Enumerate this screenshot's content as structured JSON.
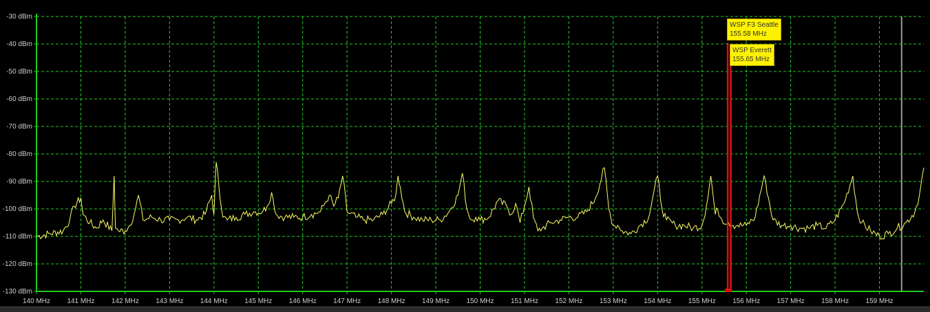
{
  "chart_data": {
    "type": "line",
    "title": "",
    "xlabel": "",
    "ylabel": "",
    "x_unit": "MHz",
    "y_unit": "dBm",
    "xlim": [
      140,
      160
    ],
    "ylim": [
      -130,
      -30
    ],
    "x_ticks": [
      "140 MHz",
      "141 MHz",
      "142 MHz",
      "143 MHz",
      "144 MHz",
      "145 MHz",
      "146 MHz",
      "147 MHz",
      "148 MHz",
      "149 MHz",
      "150 MHz",
      "151 MHz",
      "152 MHz",
      "153 MHz",
      "154 MHz",
      "155 MHz",
      "156 MHz",
      "157 MHz",
      "158 MHz",
      "159 MHz"
    ],
    "y_ticks": [
      "-30 dBm",
      "-40 dBm",
      "-50 dBm",
      "-60 dBm",
      "-70 dBm",
      "-80 dBm",
      "-90 dBm",
      "-100 dBm",
      "-110 dBm",
      "-120 dBm",
      "-130 dBm"
    ],
    "grid": true,
    "colors": {
      "background": "#000000",
      "grid": "#22cc22",
      "trace": "#ffff66",
      "marker": "#e01010",
      "cursor": "#9a9a9a",
      "label_bg": "#fff200"
    },
    "series": [
      {
        "x": [
          140.0,
          140.3,
          140.6,
          140.75,
          140.85,
          141.0,
          141.05,
          141.2,
          141.35,
          141.5,
          141.7,
          141.75,
          141.78,
          141.85,
          142.0,
          142.1,
          142.2,
          142.3,
          142.4,
          142.6,
          142.8,
          143.0,
          143.2,
          143.4,
          143.6,
          143.8,
          143.95,
          144.0,
          144.05,
          144.2,
          144.3,
          144.5,
          144.7,
          144.9,
          145.1,
          145.2,
          145.3,
          145.4,
          145.6,
          145.8,
          146.0,
          146.2,
          146.4,
          146.5,
          146.6,
          146.7,
          146.8,
          146.9,
          147.0,
          147.2,
          147.4,
          147.6,
          147.8,
          148.0,
          148.1,
          148.15,
          148.2,
          148.3,
          148.5,
          148.7,
          148.9,
          149.1,
          149.3,
          149.5,
          149.6,
          149.7,
          149.8,
          149.9,
          150.0,
          150.2,
          150.4,
          150.6,
          150.7,
          150.8,
          150.9,
          151.0,
          151.1,
          151.2,
          151.3,
          151.4,
          151.6,
          151.8,
          152.0,
          152.2,
          152.4,
          152.6,
          152.8,
          152.9,
          153.0,
          153.1,
          153.2,
          153.4,
          153.6,
          153.8,
          153.9,
          154.0,
          154.1,
          154.2,
          154.4,
          154.6,
          154.8,
          155.0,
          155.1,
          155.2,
          155.3,
          155.35,
          155.45,
          155.6,
          155.7,
          155.8,
          156.0,
          156.2,
          156.4,
          156.6,
          156.8,
          157.0,
          157.2,
          157.4,
          157.6,
          157.8,
          158.0,
          158.2,
          158.4,
          158.5,
          158.6,
          158.8,
          159.0,
          159.2,
          159.4,
          159.6,
          159.8,
          159.9,
          160.0
        ],
        "y": [
          -110,
          -109,
          -108,
          -104,
          -99,
          -96,
          -102,
          -105,
          -107,
          -104,
          -108,
          -88,
          -107,
          -108,
          -108,
          -106,
          -102,
          -95,
          -104,
          -103,
          -104,
          -104,
          -104,
          -103,
          -104,
          -102,
          -95,
          -102,
          -83,
          -103,
          -104,
          -103,
          -102,
          -101,
          -101,
          -99,
          -94,
          -102,
          -103,
          -103,
          -103,
          -102,
          -101,
          -98,
          -95,
          -99,
          -96,
          -88,
          -101,
          -103,
          -104,
          -104,
          -102,
          -98,
          -95,
          -88,
          -92,
          -101,
          -103,
          -104,
          -104,
          -104,
          -101,
          -95,
          -87,
          -100,
          -104,
          -103,
          -104,
          -103,
          -97,
          -99,
          -102,
          -98,
          -105,
          -99,
          -92,
          -103,
          -108,
          -107,
          -105,
          -104,
          -103,
          -103,
          -101,
          -96,
          -85,
          -100,
          -106,
          -106,
          -108,
          -109,
          -106,
          -103,
          -95,
          -88,
          -100,
          -104,
          -106,
          -106,
          -107,
          -106,
          -99,
          -88,
          -102,
          -100,
          -104,
          -105,
          -106,
          -106,
          -106,
          -103,
          -88,
          -104,
          -106,
          -106,
          -107,
          -107,
          -106,
          -107,
          -104,
          -98,
          -88,
          -101,
          -105,
          -108,
          -110,
          -109,
          -107,
          -105,
          -101,
          -95,
          -85
        ]
      }
    ],
    "markers": [
      {
        "label": "WSP F3 Seattle",
        "freq_text": "155.58 MHz",
        "freq": 155.58
      },
      {
        "label": "WSP Everett",
        "freq_text": "155.65 MHz",
        "freq": 155.65
      }
    ],
    "cursor_freq": 159.5
  }
}
